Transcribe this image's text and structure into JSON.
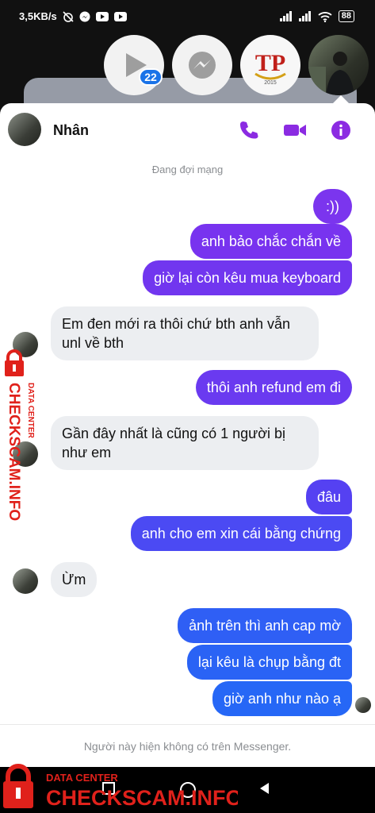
{
  "status_bar": {
    "speed": "3,5KB/s",
    "battery": "88"
  },
  "chat_heads": {
    "badge_count": "22",
    "tp_logo_text": "TP",
    "tp_logo_year": "2015"
  },
  "header": {
    "contact_name": "Nhân",
    "icons": [
      "phone-icon",
      "video-camera-icon",
      "info-icon"
    ]
  },
  "status_line": "Đang đợi mạng",
  "messages": [
    {
      "dir": "out",
      "text": ":))"
    },
    {
      "dir": "out",
      "text": "anh bảo chắc chắn về"
    },
    {
      "dir": "out",
      "text": "giờ lại còn kêu mua keyboard"
    },
    {
      "dir": "in",
      "text": "Em đen mới ra thôi chứ bth anh vẫn unl về bth"
    },
    {
      "dir": "out",
      "text": "thôi anh refund em đi"
    },
    {
      "dir": "in",
      "text": "Gần đây nhất là cũng có 1 người bị như em"
    },
    {
      "dir": "out",
      "text": "đâu"
    },
    {
      "dir": "out",
      "text": "anh cho em xin cái bằng chứng"
    },
    {
      "dir": "in",
      "text": "Ừm"
    },
    {
      "dir": "out",
      "text": "ảnh trên thì anh cap mờ"
    },
    {
      "dir": "out",
      "text": "lại kêu là chụp bằng đt"
    },
    {
      "dir": "out",
      "text": "giờ anh như nào ạ"
    }
  ],
  "footer_text": "Người này hiện không có trên Messenger.",
  "watermark": {
    "top_line": "DATA CENTER",
    "brand": "CHECKSCAM.INFO"
  },
  "colors": {
    "outgoing_gradient_top": "#8a2be2",
    "outgoing_gradient_bottom": "#1e6ef5",
    "accent_icon": "#8b2be2",
    "watermark_red": "#e0211b"
  }
}
